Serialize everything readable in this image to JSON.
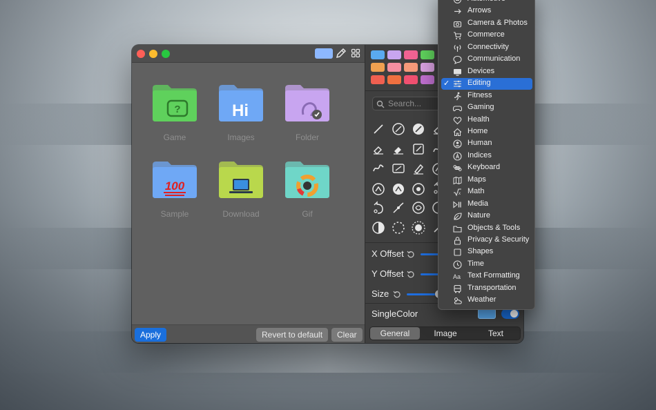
{
  "window": {
    "toolbar": {
      "swatch_color": "#8db8ff",
      "eyedropper_icon": "eyedropper-icon",
      "grid_icon": "grid-icon"
    },
    "folders": [
      {
        "label": "Game",
        "color": "#5fd15c",
        "glyph": "?"
      },
      {
        "label": "Images",
        "color": "#6fa8f5",
        "glyph": "Hi"
      },
      {
        "label": "Folder",
        "color": "#c8a5f0",
        "glyph": "ear"
      },
      {
        "label": "Sample",
        "color": "#6fa8f5",
        "glyph": "100"
      },
      {
        "label": "Download",
        "color": "#b9d84c",
        "glyph": "laptop"
      },
      {
        "label": "Gif",
        "color": "#6fd6c8",
        "glyph": "ring"
      }
    ],
    "buttons": {
      "apply": "Apply",
      "revert": "Revert to default",
      "clear": "Clear"
    },
    "right_pane": {
      "palette_colors": [
        "#5aaaf0",
        "#c8a5f0",
        "#f06292",
        "#5fd15c",
        "#f0a050",
        "#f48fa0",
        "#f59a7a",
        "#d9a0e0",
        "#f06050",
        "#f07040",
        "#f05070",
        "#c070d0"
      ],
      "search_placeholder": "Search...",
      "sliders": [
        {
          "label": "X Offset",
          "value": 0.5
        },
        {
          "label": "Y Offset",
          "value": 0.5
        },
        {
          "label": "Size",
          "value": 0.3
        }
      ],
      "single_color_label": "SingleColor",
      "single_color_value": "#5aaaf0",
      "single_color_enabled": true,
      "tabs": [
        "General",
        "Image",
        "Text"
      ],
      "active_tab": "General"
    }
  },
  "menu": {
    "items": [
      {
        "label": "Automotive",
        "icon": "car-icon"
      },
      {
        "label": "Arrows",
        "icon": "arrow-right-icon"
      },
      {
        "label": "Camera & Photos",
        "icon": "camera-icon"
      },
      {
        "label": "Commerce",
        "icon": "cart-icon"
      },
      {
        "label": "Connectivity",
        "icon": "antenna-icon"
      },
      {
        "label": "Communication",
        "icon": "speech-bubble-icon"
      },
      {
        "label": "Devices",
        "icon": "display-icon"
      },
      {
        "label": "Editing",
        "icon": "sliders-icon",
        "selected": true
      },
      {
        "label": "Fitness",
        "icon": "running-figure-icon"
      },
      {
        "label": "Gaming",
        "icon": "gamecontroller-icon"
      },
      {
        "label": "Health",
        "icon": "heart-icon"
      },
      {
        "label": "Home",
        "icon": "house-icon"
      },
      {
        "label": "Human",
        "icon": "person-circle-icon"
      },
      {
        "label": "Indices",
        "icon": "letter-circle-icon"
      },
      {
        "label": "Keyboard",
        "icon": "command-icon"
      },
      {
        "label": "Maps",
        "icon": "map-icon"
      },
      {
        "label": "Math",
        "icon": "sqrt-icon"
      },
      {
        "label": "Media",
        "icon": "play-pause-icon"
      },
      {
        "label": "Nature",
        "icon": "leaf-icon"
      },
      {
        "label": "Objects & Tools",
        "icon": "folder-icon"
      },
      {
        "label": "Privacy & Security",
        "icon": "lock-icon"
      },
      {
        "label": "Shapes",
        "icon": "square-icon"
      },
      {
        "label": "Time",
        "icon": "clock-icon"
      },
      {
        "label": "Text Formatting",
        "icon": "textformat-icon"
      },
      {
        "label": "Transportation",
        "icon": "bus-icon"
      },
      {
        "label": "Weather",
        "icon": "cloud-sun-icon"
      }
    ]
  }
}
